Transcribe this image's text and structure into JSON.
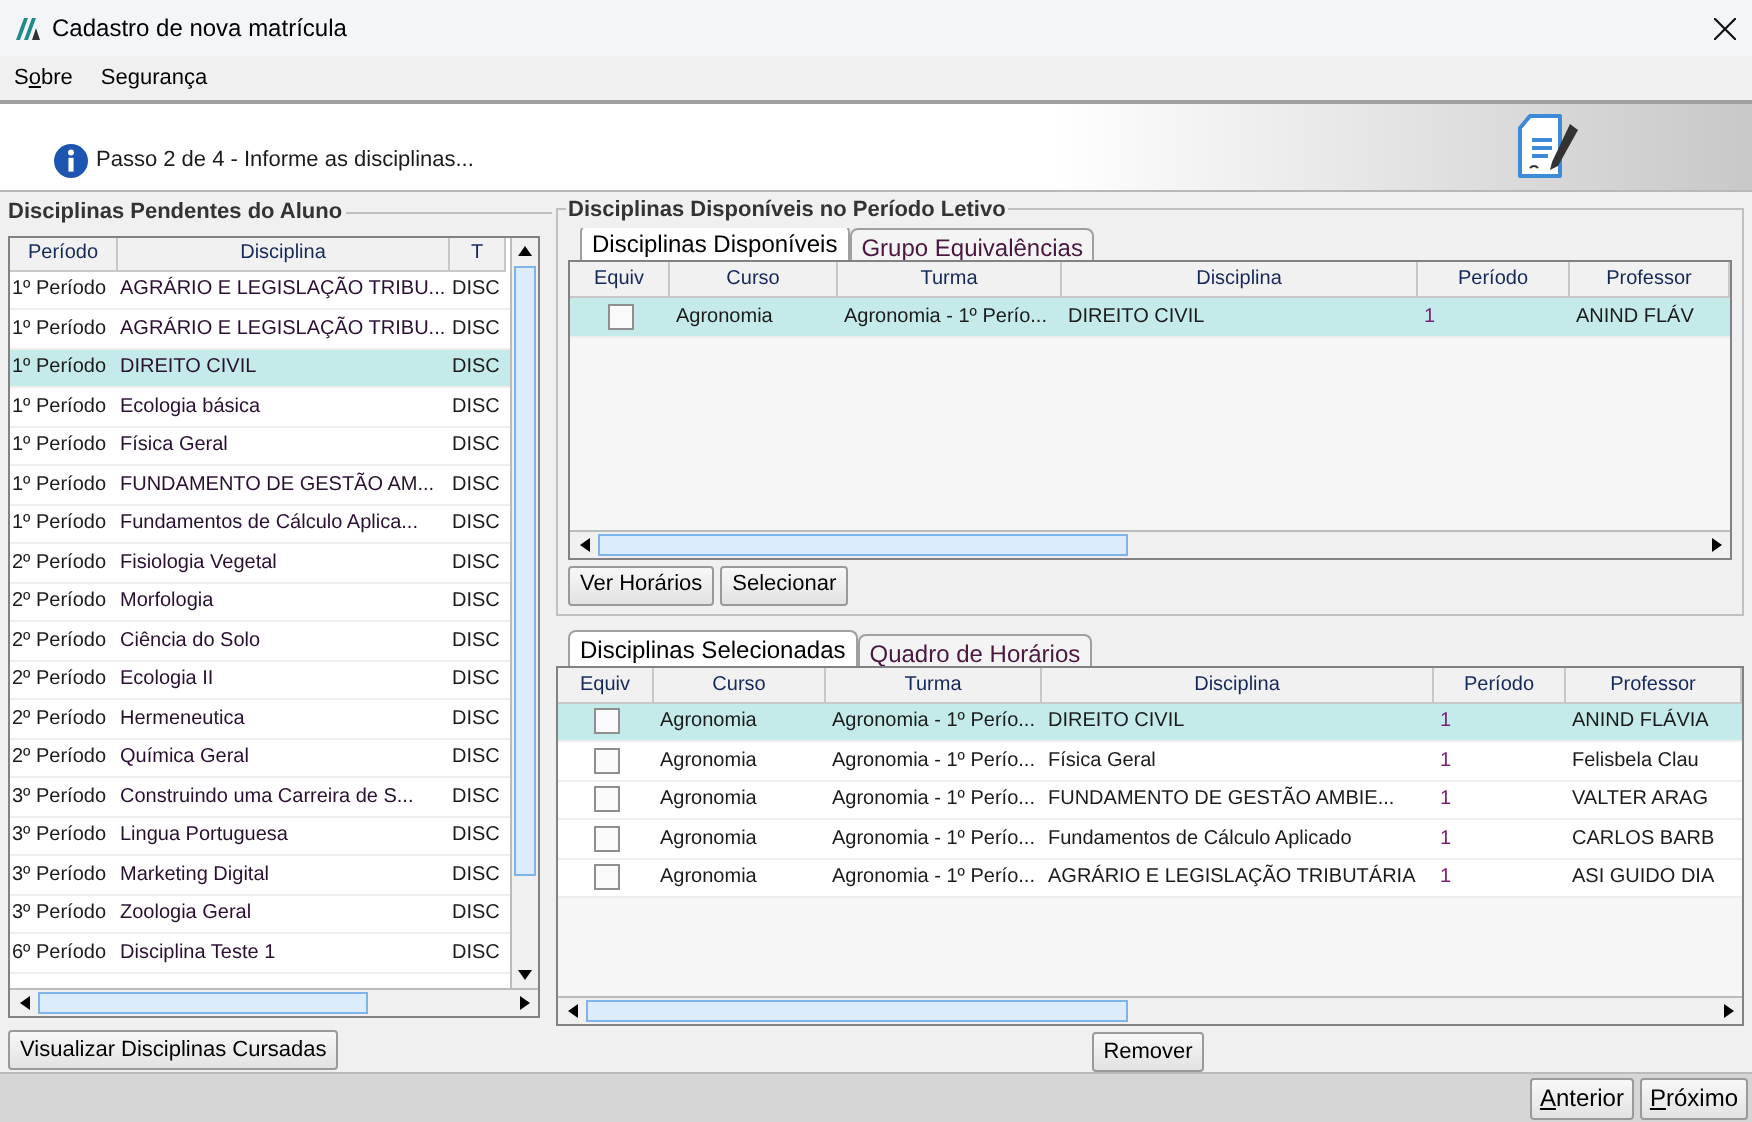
{
  "window": {
    "title": "Cadastro de nova matrícula"
  },
  "menu": [
    {
      "pre": "S",
      "key": "o",
      "post": "bre"
    },
    {
      "pre": "Segurança"
    }
  ],
  "step": {
    "text": "Passo 2 de 4 - Informe as disciplinas..."
  },
  "pending": {
    "title": "Disciplinas Pendentes do Aluno",
    "columns": [
      "Período",
      "Disciplina",
      "T"
    ],
    "rows": [
      {
        "cells": [
          "1º Período",
          "AGRÁRIO E LEGISLAÇÃO TRIBU...",
          "DISC"
        ],
        "selected": false
      },
      {
        "cells": [
          "1º Período",
          "AGRÁRIO E LEGISLAÇÃO TRIBU...",
          "DISC"
        ],
        "selected": false
      },
      {
        "cells": [
          "1º Período",
          "DIREITO CIVIL",
          "DISC"
        ],
        "selected": true
      },
      {
        "cells": [
          "1º Período",
          "Ecologia básica",
          "DISC"
        ],
        "selected": false
      },
      {
        "cells": [
          "1º Período",
          "Física Geral",
          "DISC"
        ],
        "selected": false
      },
      {
        "cells": [
          "1º Período",
          "FUNDAMENTO DE GESTÃO AM...",
          "DISC"
        ],
        "selected": false
      },
      {
        "cells": [
          "1º Período",
          "Fundamentos de Cálculo Aplica...",
          "DISC"
        ],
        "selected": false
      },
      {
        "cells": [
          "2º Período",
          "Fisiologia Vegetal",
          "DISC"
        ],
        "selected": false
      },
      {
        "cells": [
          "2º Período",
          "Morfologia",
          "DISC"
        ],
        "selected": false
      },
      {
        "cells": [
          "2º Período",
          "Ciência do Solo",
          "DISC"
        ],
        "selected": false
      },
      {
        "cells": [
          "2º Período",
          "Ecologia II",
          "DISC"
        ],
        "selected": false
      },
      {
        "cells": [
          "2º Período",
          "Hermeneutica",
          "DISC"
        ],
        "selected": false
      },
      {
        "cells": [
          "2º Período",
          "Química Geral",
          "DISC"
        ],
        "selected": false
      },
      {
        "cells": [
          "3º Período",
          "Construindo uma Carreira de S...",
          "DISC"
        ],
        "selected": false
      },
      {
        "cells": [
          "3º Período",
          "Lingua Portuguesa",
          "DISC"
        ],
        "selected": false
      },
      {
        "cells": [
          "3º Período",
          "Marketing Digital",
          "DISC"
        ],
        "selected": false
      },
      {
        "cells": [
          "3º Período",
          "Zoologia Geral",
          "DISC"
        ],
        "selected": false
      },
      {
        "cells": [
          "6º Período",
          "Disciplina Teste 1",
          "DISC"
        ],
        "selected": false
      }
    ],
    "button": "Visualizar Disciplinas Cursadas"
  },
  "available": {
    "title": "Disciplinas Disponíveis no Período Letivo",
    "tabs": [
      {
        "label": "Disciplinas Disponíveis",
        "selected": true
      },
      {
        "label": "Grupo Equivalências",
        "selected": false
      }
    ],
    "check_column": "Equiv",
    "columns": [
      "Curso",
      "Turma",
      "Disciplina",
      "Período",
      "Professor"
    ],
    "rows": [
      {
        "checked": false,
        "cells": [
          "Agronomia",
          "Agronomia - 1º Perío...",
          "DIREITO CIVIL",
          "1",
          "ANIND FLÁV"
        ],
        "selected": true
      }
    ],
    "buttons": [
      "Ver Horários",
      "Selecionar"
    ]
  },
  "selected_list": {
    "tabs": [
      {
        "label": "Disciplinas Selecionadas",
        "selected": true
      },
      {
        "label": "Quadro de Horários",
        "selected": false
      }
    ],
    "check_column": "Equiv",
    "columns": [
      "Curso",
      "Turma",
      "Disciplina",
      "Período",
      "Professor"
    ],
    "rows": [
      {
        "checked": false,
        "cells": [
          "Agronomia",
          "Agronomia - 1º Perío...",
          "DIREITO CIVIL",
          "1",
          "ANIND FLÁVIA"
        ],
        "selected": true
      },
      {
        "checked": false,
        "cells": [
          "Agronomia",
          "Agronomia - 1º Perío...",
          "Física Geral",
          "1",
          "Felisbela Clau"
        ],
        "selected": false
      },
      {
        "checked": false,
        "cells": [
          "Agronomia",
          "Agronomia - 1º Perío...",
          "FUNDAMENTO DE GESTÃO AMBIE...",
          "1",
          "VALTER ARAG"
        ],
        "selected": false
      },
      {
        "checked": false,
        "cells": [
          "Agronomia",
          "Agronomia - 1º Perío...",
          "Fundamentos de Cálculo Aplicado",
          "1",
          "CARLOS BARB"
        ],
        "selected": false
      },
      {
        "checked": false,
        "cells": [
          "Agronomia",
          "Agronomia - 1º Perío...",
          "AGRÁRIO E LEGISLAÇÃO TRIBUTÁRIA",
          "1",
          "ASI GUIDO DIA"
        ],
        "selected": false
      }
    ],
    "button": "Remover"
  },
  "footer": {
    "buttons": [
      {
        "key": "A",
        "post": "nterior"
      },
      {
        "key": "P",
        "post": "róximo"
      }
    ]
  }
}
